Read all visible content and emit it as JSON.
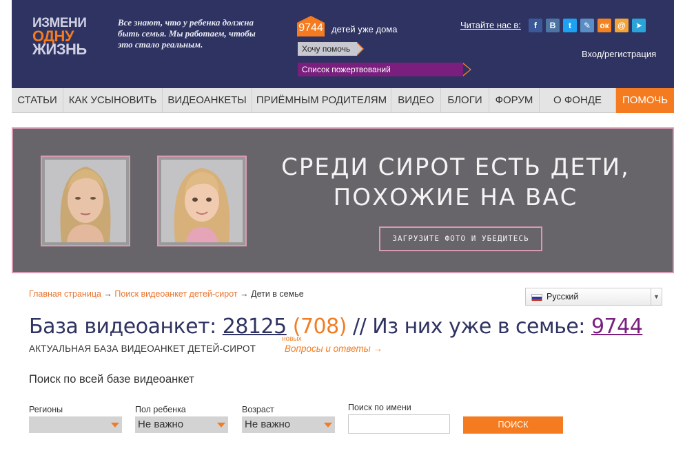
{
  "header": {
    "logo": {
      "line1": "ИЗМЕНИ",
      "line2": "ОДНУ",
      "line3": "ЖИЗНЬ"
    },
    "tagline": "Все знают, что у ребенка должна быть семья. Мы работаем, чтобы это стало реальным.",
    "counter": {
      "value": "9744",
      "label": "детей уже дома"
    },
    "help_button": "Хочу помочь",
    "donations_button": "Список пожертвований",
    "read_us": "Читайте нас в:",
    "social": [
      {
        "icon": "facebook-icon",
        "glyph": "f",
        "color": "#3b5998"
      },
      {
        "icon": "vkontakte-icon",
        "glyph": "В",
        "color": "#4c75a3"
      },
      {
        "icon": "twitter-icon",
        "glyph": "t",
        "color": "#1da1f2"
      },
      {
        "icon": "livejournal-icon",
        "glyph": "✎",
        "color": "#5b8dc5"
      },
      {
        "icon": "odnoklassniki-icon",
        "glyph": "ок",
        "color": "#f58220"
      },
      {
        "icon": "mailru-icon",
        "glyph": "@",
        "color": "#f2a33a"
      },
      {
        "icon": "telegram-icon",
        "glyph": "➤",
        "color": "#2aa3d9"
      }
    ],
    "login": "Вход/регистрация"
  },
  "nav": {
    "items": [
      "СТАТЬИ",
      "КАК УСЫНОВИТЬ",
      "ВИДЕОАНКЕТЫ",
      "ПРИЁМНЫМ РОДИТЕЛЯМ",
      "ВИДЕО",
      "БЛОГИ",
      "ФОРУМ",
      "О ФОНДЕ"
    ],
    "help": "ПОМОЧЬ"
  },
  "banner": {
    "headline_line1": "СРЕДИ СИРОТ ЕСТЬ ДЕТИ,",
    "headline_line2": "ПОХОЖИЕ НА ВАС",
    "cta": "ЗАГРУЗИТЕ ФОТО И УБЕДИТЕСЬ"
  },
  "breadcrumb": {
    "home": "Главная страница",
    "search": "Поиск видеоанкет детей-сирот",
    "current": "Дети в семье",
    "separator": "→"
  },
  "language": {
    "selected": "Русский"
  },
  "database": {
    "label": "База видеоанкет:",
    "total": "28125",
    "new_count": "(708)",
    "new_label": "новых",
    "in_family_label": "// Из них уже в семье:",
    "in_family": "9744",
    "subtitle": "АКТУАЛЬНАЯ БАЗА ВИДЕОАНКЕТ ДЕТЕЙ-СИРОТ",
    "faq": "Вопросы и ответы →"
  },
  "search": {
    "heading": "Поиск по всей базе видеоанкет",
    "regions": {
      "label": "Регионы",
      "value": ""
    },
    "gender": {
      "label": "Пол ребенка",
      "value": "Не важно"
    },
    "age": {
      "label": "Возраст",
      "value": "Не важно"
    },
    "name": {
      "label": "Поиск по имени",
      "value": ""
    },
    "button": "ПОИСК"
  },
  "colors": {
    "header_bg": "#2f3361",
    "accent_orange": "#f47b20",
    "accent_purple": "#7a1f7e",
    "banner_bg": "#67646a",
    "banner_border": "#d99bb4"
  }
}
